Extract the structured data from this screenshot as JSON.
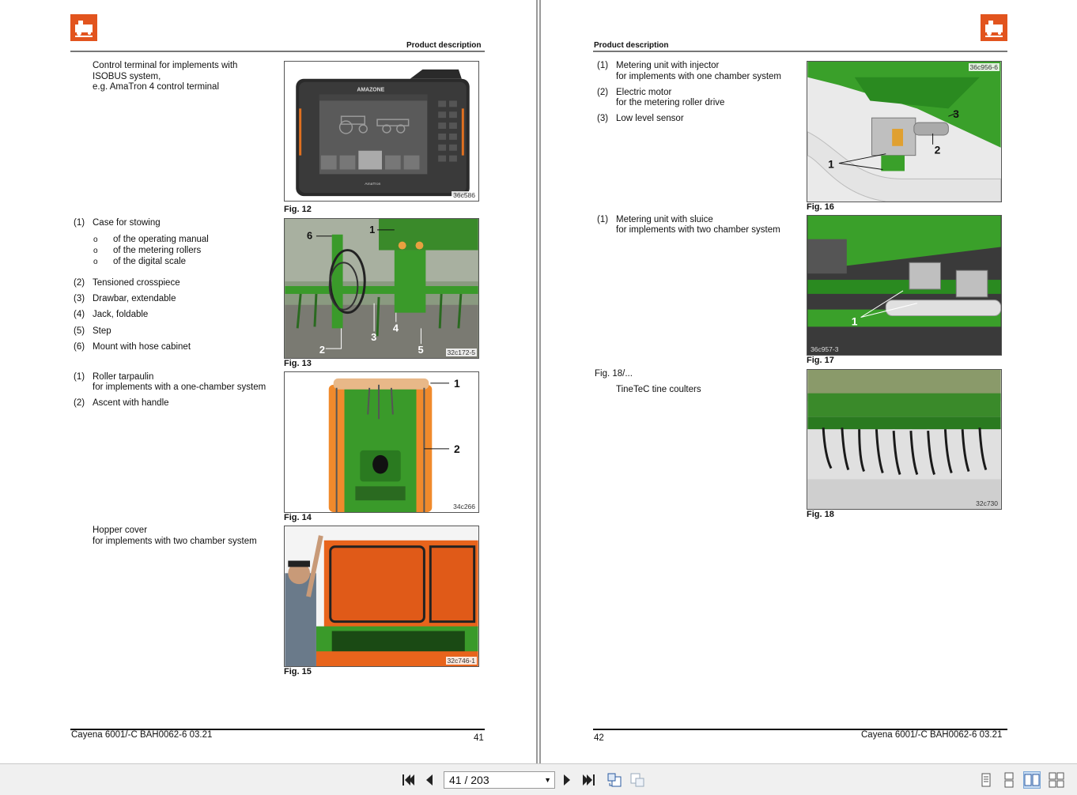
{
  "left_page": {
    "header_title": "Product description",
    "section_terminal": {
      "lines": [
        "Control terminal for implements with",
        "ISOBUS system,",
        "e.g. AmaTron 4 control terminal"
      ]
    },
    "fig12": {
      "code": "36c586",
      "caption": "Fig. 12",
      "brand": "AMAZONE",
      "brand2": "AmaTron"
    },
    "section_fig13": {
      "items": [
        {
          "num": "(1)",
          "text": "Case for stowing"
        },
        {
          "num": "(2)",
          "text": "Tensioned crosspiece"
        },
        {
          "num": "(3)",
          "text": "Drawbar, extendable"
        },
        {
          "num": "(4)",
          "text": "Jack, foldable"
        },
        {
          "num": "(5)",
          "text": "Step"
        },
        {
          "num": "(6)",
          "text": "Mount with hose cabinet"
        }
      ],
      "sub_bullets": [
        {
          "bullet": "o",
          "text": "of the operating manual"
        },
        {
          "bullet": "o",
          "text": "of the metering rollers"
        },
        {
          "bullet": "o",
          "text": "of the digital scale"
        }
      ]
    },
    "fig13": {
      "code": "32c172-5",
      "caption": "Fig. 13",
      "labels": [
        "6",
        "1",
        "2",
        "3",
        "4",
        "5"
      ]
    },
    "section_fig14": {
      "items": [
        {
          "num": "(1)",
          "text": "Roller tarpaulin",
          "text2": "for implements with a one-chamber system"
        },
        {
          "num": "(2)",
          "text": "Ascent with handle"
        }
      ]
    },
    "fig14": {
      "code": "34c266",
      "caption": "Fig. 14",
      "labels": [
        "1",
        "2"
      ]
    },
    "section_fig15": {
      "lines": [
        "Hopper cover",
        "for implements with two chamber system"
      ]
    },
    "fig15": {
      "code": "32c746-1",
      "caption": "Fig. 15"
    },
    "footer_doc": "Cayena 6001/-C  BAH0062-6  03.21",
    "page_number": "41"
  },
  "right_page": {
    "header_title": "Product description",
    "section_fig16": {
      "items": [
        {
          "num": "(1)",
          "text": "Metering unit with injector",
          "text2": "for implements with one chamber system"
        },
        {
          "num": "(2)",
          "text": "Electric motor",
          "text2": "for the metering roller drive"
        },
        {
          "num": "(3)",
          "text": "Low level sensor"
        }
      ]
    },
    "fig16": {
      "code": "36c956-6",
      "caption": "Fig. 16",
      "labels": [
        "1",
        "2",
        "3"
      ]
    },
    "section_fig17": {
      "items": [
        {
          "num": "(1)",
          "text": "Metering unit with sluice",
          "text2": "for implements with two chamber system"
        }
      ]
    },
    "fig17": {
      "code": "36c957-3",
      "caption": "Fig. 17",
      "labels": [
        "1"
      ]
    },
    "section_fig18": {
      "ref": "Fig. 18/...",
      "text": "TineTeC tine coulters"
    },
    "fig18": {
      "code": "32c730",
      "caption": "Fig. 18"
    },
    "footer_doc": "Cayena 6001/-C  BAH0062-6  03.21",
    "page_number": "42"
  },
  "toolbar": {
    "page_indicator": "41 / 203",
    "buttons": [
      "first-page",
      "previous-page",
      "next-page",
      "last-page",
      "rotate-back",
      "rotate-forward",
      "single-page-view",
      "continuous-view",
      "two-page-view",
      "continuous-two-page-view"
    ]
  },
  "colors": {
    "brand_orange": "#e2541e",
    "machine_green": "#3a9a2a",
    "hopper_orange": "#f08a2c"
  }
}
